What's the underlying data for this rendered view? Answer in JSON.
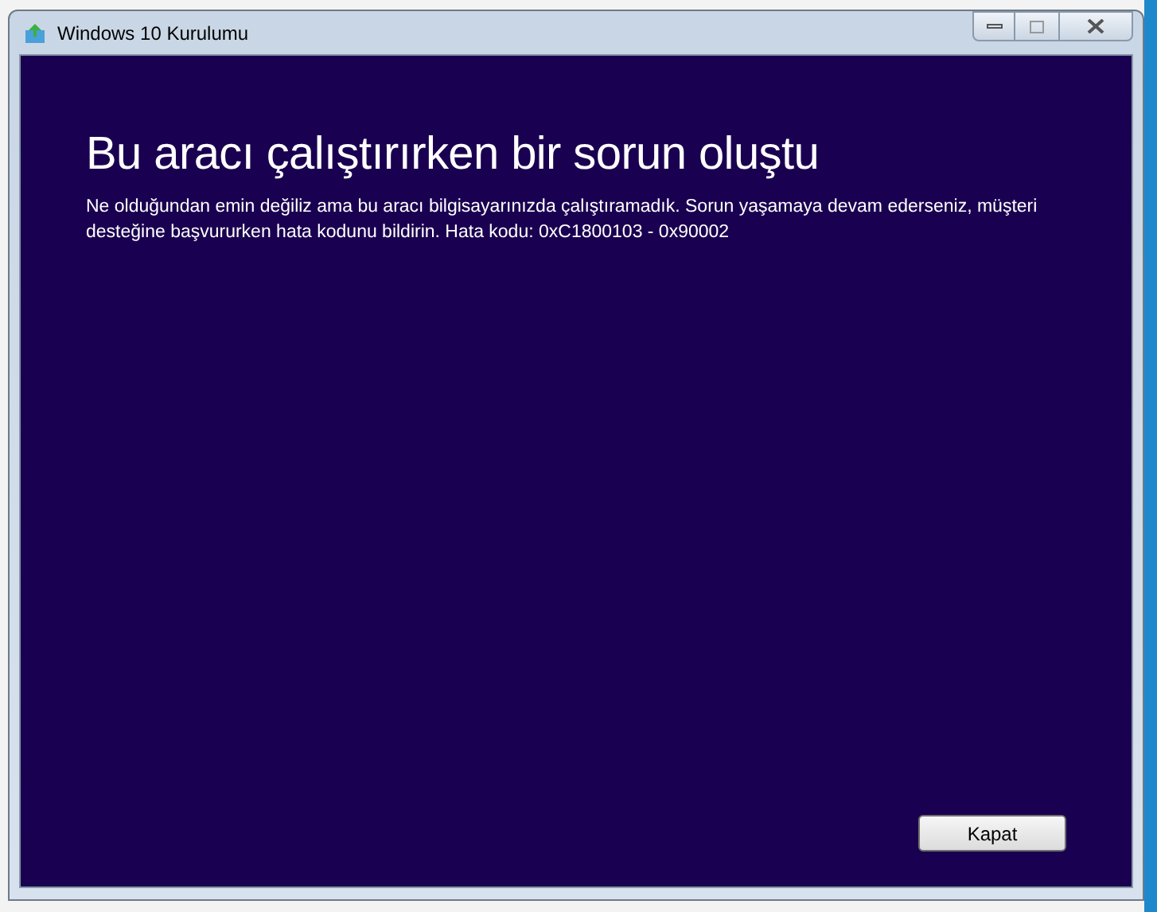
{
  "window": {
    "title": "Windows 10 Kurulumu"
  },
  "heading": "Bu aracı çalıştırırken bir sorun oluştu",
  "message": "Ne olduğundan emin değiliz ama bu aracı bilgisayarınızda çalıştıramadık. Sorun yaşamaya devam ederseniz, müşteri desteğine başvururken hata kodunu bildirin. Hata kodu: 0xC1800103 - 0x90002",
  "buttons": [
    "Kapat"
  ]
}
